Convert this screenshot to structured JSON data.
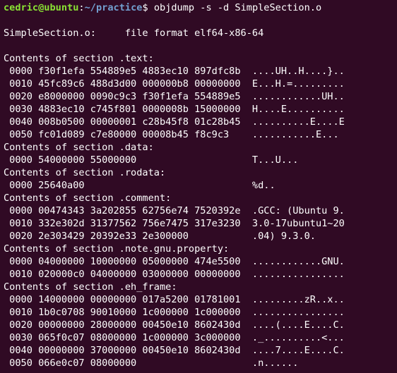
{
  "prompt": {
    "user_host": "cedric@ubuntu",
    "separator": ":",
    "path": "~/practice",
    "symbol": "$ ",
    "command": "objdump -s -d SimpleSection.o"
  },
  "output": [
    "",
    "SimpleSection.o:     file format elf64-x86-64",
    "",
    "Contents of section .text:",
    " 0000 f30f1efa 554889e5 4883ec10 897dfc8b  ....UH..H....}..",
    " 0010 45fc89c6 488d3d00 000000b8 00000000  E...H.=.........",
    " 0020 e8000000 0090c9c3 f30f1efa 554889e5  ............UH..",
    " 0030 4883ec10 c745f801 0000008b 15000000  H....E..........",
    " 0040 008b0500 00000001 c28b45f8 01c28b45  ..........E....E",
    " 0050 fc01d089 c7e80000 00008b45 f8c9c3    ...........E...",
    "Contents of section .data:",
    " 0000 54000000 55000000                    T...U...",
    "Contents of section .rodata:",
    " 0000 25640a00                             %d..",
    "Contents of section .comment:",
    " 0000 00474343 3a202855 62756e74 7520392e  .GCC: (Ubuntu 9.",
    " 0010 332e302d 31377562 756e7475 317e3230  3.0-17ubuntu1~20",
    " 0020 2e303429 20392e33 2e300000           .04) 9.3.0.",
    "Contents of section .note.gnu.property:",
    " 0000 04000000 10000000 05000000 474e5500  ............GNU.",
    " 0010 020000c0 04000000 03000000 00000000  ................",
    "Contents of section .eh_frame:",
    " 0000 14000000 00000000 017a5200 01781001  .........zR..x..",
    " 0010 1b0c0708 90010000 1c000000 1c000000  ................",
    " 0020 00000000 28000000 00450e10 8602430d  ....(....E....C.",
    " 0030 065f0c07 08000000 1c000000 3c000000  ._..........<...",
    " 0040 00000000 37000000 00450e10 8602430d  ....7....E....C.",
    " 0050 066e0c07 08000000                    .n......"
  ],
  "colors": {
    "background": "#300a24",
    "prompt_user": "#8ae234",
    "prompt_path": "#729fcf",
    "text": "#ffffff"
  }
}
